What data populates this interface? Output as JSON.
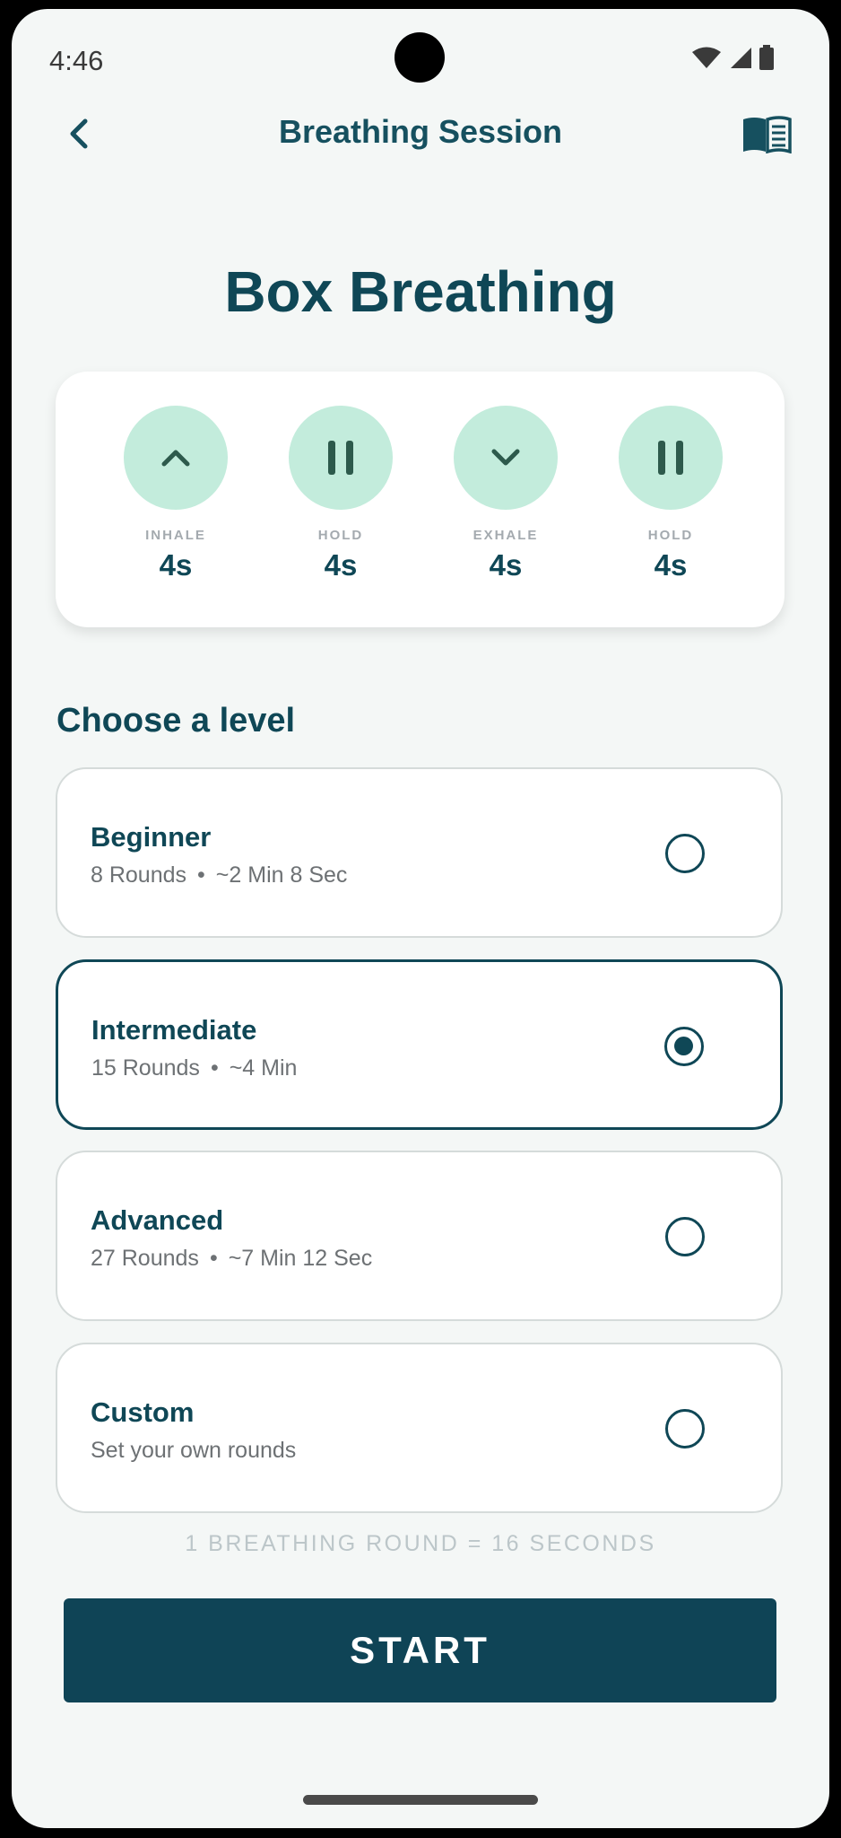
{
  "status_bar": {
    "time": "4:46"
  },
  "header": {
    "title": "Breathing Session",
    "back_icon": "chevron-left-icon",
    "book_icon": "book-icon"
  },
  "title": "Box Breathing",
  "phases": [
    {
      "label": "INHALE",
      "value": "4s",
      "icon": "chevron-up-icon"
    },
    {
      "label": "HOLD",
      "value": "4s",
      "icon": "pause-icon"
    },
    {
      "label": "EXHALE",
      "value": "4s",
      "icon": "chevron-down-icon"
    },
    {
      "label": "HOLD",
      "value": "4s",
      "icon": "pause-icon"
    }
  ],
  "levels_section": {
    "title": "Choose a level",
    "levels": [
      {
        "name": "Beginner",
        "rounds": "8 Rounds",
        "duration": "~2 Min 8 Sec",
        "selected": false
      },
      {
        "name": "Intermediate",
        "rounds": "15 Rounds",
        "duration": "~4 Min",
        "selected": true
      },
      {
        "name": "Advanced",
        "rounds": "27 Rounds",
        "duration": "~7 Min 12 Sec",
        "selected": false
      },
      {
        "name": "Custom",
        "subtitle": "Set your own rounds",
        "selected": false
      }
    ]
  },
  "footnote": "1 BREATHING ROUND = 16 SECONDS",
  "start_button": "START",
  "colors": {
    "primary": "#0f4756",
    "accent": "#c3ecdc",
    "background": "#f4f7f6"
  }
}
